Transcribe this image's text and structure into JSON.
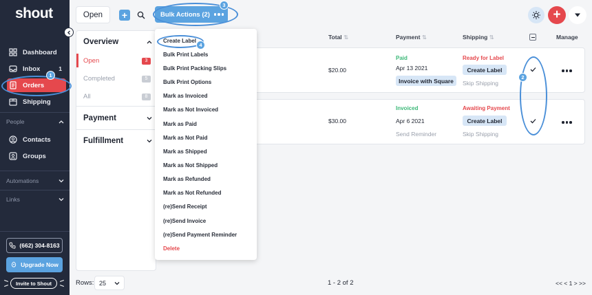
{
  "app": {
    "logo": "shout"
  },
  "sidebar": {
    "nav": [
      {
        "label": "Dashboard",
        "icon": "dashboard-icon"
      },
      {
        "label": "Inbox",
        "icon": "inbox-icon",
        "count": "1"
      },
      {
        "label": "Orders",
        "icon": "orders-icon",
        "active": true
      },
      {
        "label": "Shipping",
        "icon": "shipping-icon"
      }
    ],
    "people_section": "People",
    "people": [
      {
        "label": "Contacts",
        "icon": "contacts-icon"
      },
      {
        "label": "Groups",
        "icon": "groups-icon"
      }
    ],
    "automations_section": "Automations",
    "links_section": "Links",
    "phone": "(662) 304-8163",
    "upgrade_label": "Upgrade Now",
    "invite_label": "Invite to Shout"
  },
  "topbar": {
    "open_tab": "Open",
    "bulk_actions_label": "Bulk Actions (2)"
  },
  "filters": {
    "overview": "Overview",
    "items": [
      {
        "label": "Open",
        "count": "3",
        "active": true
      },
      {
        "label": "Completed",
        "count": "5"
      },
      {
        "label": "All",
        "count": "8"
      }
    ],
    "payment": "Payment",
    "fulfillment": "Fulfillment"
  },
  "table": {
    "headers": {
      "total": "Total",
      "payment": "Payment",
      "shipping": "Shipping",
      "manage": "Manage"
    },
    "rows": [
      {
        "total": "$20.00",
        "payment_status": "Paid",
        "payment_color": "#3cb878",
        "date": "Apr 13 2021",
        "payment_action": "Invoice with Square",
        "shipping_status": "Ready for Label",
        "shipping_color": "#e5484d",
        "ship_action": "Create Label",
        "ship_secondary": "Skip Shipping"
      },
      {
        "total": "$30.00",
        "payment_status": "Invoiced",
        "payment_color": "#3cb878",
        "date": "Apr 6 2021",
        "payment_action": "Send Reminder",
        "shipping_status": "Awaiting Payment",
        "shipping_color": "#e5484d",
        "ship_action": "Create Label",
        "ship_secondary": "Skip Shipping"
      }
    ]
  },
  "bulk_menu": {
    "items": [
      "Create Label",
      "Bulk Print Labels",
      "Bulk Print Packing Slips",
      "Bulk Print Options",
      "Mark as Invoiced",
      "Mark as Not Invoiced",
      "Mark as Paid",
      "Mark as Not Paid",
      "Mark as Shipped",
      "Mark as Not Shipped",
      "Mark as Refunded",
      "Mark as Not Refunded",
      "(re)Send Receipt",
      "(re)Send Invoice",
      "(re)Send Payment Reminder"
    ],
    "delete_label": "Delete"
  },
  "footer": {
    "rows_label": "Rows:",
    "rows_value": "25",
    "range": "1 - 2 of 2",
    "pager": "<< < 1 > >>"
  },
  "annotations": [
    "1",
    "2",
    "3",
    "4"
  ],
  "colors": {
    "accent": "#5ba3e0",
    "brand_red": "#e5484d",
    "sidebar_bg": "#232a3b",
    "success": "#3cb878"
  }
}
